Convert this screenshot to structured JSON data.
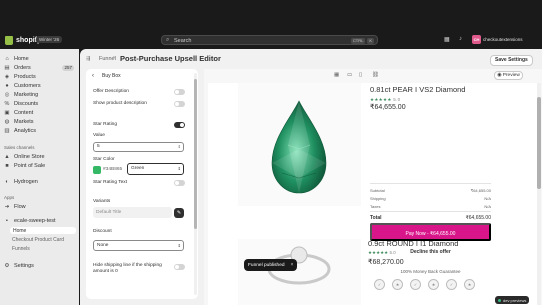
{
  "topbar": {
    "logo_text": "shopify",
    "badge": "Winter '26",
    "search_placeholder": "Search",
    "shortcut_keys": [
      "CTRL",
      "K"
    ],
    "avatar_initials": "CH",
    "store_name": "checkoutextensions"
  },
  "sidebar": {
    "items": [
      {
        "label": "Home",
        "icon": "home-icon"
      },
      {
        "label": "Orders",
        "icon": "orders-icon",
        "badge": "257"
      },
      {
        "label": "Products",
        "icon": "tag-icon"
      },
      {
        "label": "Customers",
        "icon": "person-icon"
      },
      {
        "label": "Marketing",
        "icon": "target-icon"
      },
      {
        "label": "Discounts",
        "icon": "discount-icon"
      },
      {
        "label": "Content",
        "icon": "content-icon"
      },
      {
        "label": "Markets",
        "icon": "globe-icon"
      },
      {
        "label": "Analytics",
        "icon": "chart-icon"
      }
    ],
    "channels_heading": "Sales channels",
    "channels": [
      {
        "label": "Online Store",
        "icon": "store-icon"
      },
      {
        "label": "Point of Sale",
        "icon": "pos-icon"
      }
    ],
    "hydrogen": "Hydrogen",
    "apps_heading": "Apps",
    "apps": [
      {
        "label": "Flow"
      },
      {
        "label": "ecale-sweep-test"
      }
    ],
    "app_subitems": [
      {
        "label": "Home",
        "active": true
      },
      {
        "label": "Checkout Product Card"
      },
      {
        "label": "Funnels"
      }
    ],
    "settings": "Settings"
  },
  "header": {
    "crumb": "Funnel",
    "title": "Post-Purchase Upsell Editor",
    "save_label": "Save Settings"
  },
  "panel": {
    "back_symbol": "‹",
    "title": "Buy Box",
    "rows": {
      "offer_description": {
        "label": "Offer Description",
        "on": false
      },
      "show_product_description": {
        "label": "Show product description",
        "on": false
      },
      "star_rating": {
        "label": "Star Rating",
        "on": true
      },
      "value_label": "Value",
      "value": "5",
      "star_color_label": "Star Color",
      "star_color_hex": "#34B865",
      "star_color_name": "Green",
      "star_rating_text": {
        "label": "Star Rating Text",
        "on": false
      },
      "variants_label": "Variants",
      "default_title": "Default Title",
      "discount_label": "Discount",
      "discount_value": "None",
      "hide_shipping": {
        "label": "Hide shipping line if the shipping amount is 0",
        "on": false
      }
    }
  },
  "preview": {
    "preview_label": "Preview",
    "product1": {
      "title": "0.81ct PEAR I VS2 Diamond",
      "stars": "★★★★★",
      "rating": "5.0",
      "price": "₹64,655.00"
    },
    "summary": [
      {
        "label": "Subtotal",
        "value": "₹64,655.00"
      },
      {
        "label": "Shipping",
        "value": "N/A"
      },
      {
        "label": "Taxes",
        "value": "N/A"
      }
    ],
    "total_label": "Total",
    "total_value": "₹64,655.00",
    "pay_label": "Pay Now - ₹64,655.00",
    "decline_label": "Decline this offer",
    "guarantee": "100% Money Back Guarantee",
    "product2": {
      "title": "0.9ct ROUND I I1 Diamond",
      "stars": "★★★★★",
      "rating": "5.0",
      "price": "₹68,270.00"
    },
    "accent_color": "#D9158A",
    "gem_color": "#2e9b6e"
  },
  "toast": {
    "message": "Funnel published",
    "close": "×"
  },
  "dev_pill": {
    "label": "dev previews"
  }
}
